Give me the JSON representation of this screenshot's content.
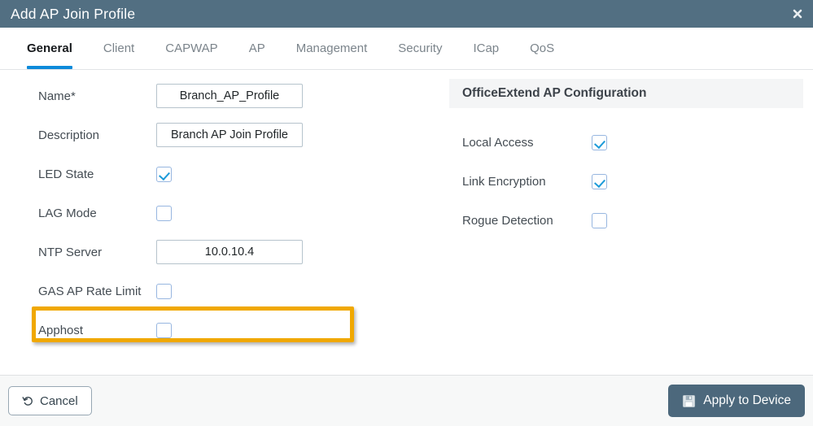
{
  "window": {
    "title": "Add AP Join Profile",
    "close_icon": "close-icon",
    "header_color": "#526f82"
  },
  "tabs": [
    {
      "label": "General",
      "active": true
    },
    {
      "label": "Client",
      "active": false
    },
    {
      "label": "CAPWAP",
      "active": false
    },
    {
      "label": "AP",
      "active": false
    },
    {
      "label": "Management",
      "active": false
    },
    {
      "label": "Security",
      "active": false
    },
    {
      "label": "ICap",
      "active": false
    },
    {
      "label": "QoS",
      "active": false
    }
  ],
  "accent_color": "#0d8ada",
  "general_form": {
    "fields": [
      {
        "label": "Name*",
        "type": "text",
        "value": "Branch_AP_Profile"
      },
      {
        "label": "Description",
        "type": "text",
        "value": "Branch AP Join Profile"
      },
      {
        "label": "LED State",
        "type": "checkbox",
        "checked": true
      },
      {
        "label": "LAG Mode",
        "type": "checkbox",
        "checked": false
      },
      {
        "label": "NTP Server",
        "type": "text",
        "value": "10.0.10.4"
      },
      {
        "label": "GAS AP Rate Limit",
        "type": "checkbox",
        "checked": false
      },
      {
        "label": "Apphost",
        "type": "checkbox",
        "checked": false
      }
    ]
  },
  "officeextend": {
    "section_title": "OfficeExtend AP Configuration",
    "fields": [
      {
        "label": "Local Access",
        "checked": true
      },
      {
        "label": "Link Encryption",
        "checked": true
      },
      {
        "label": "Rogue Detection",
        "checked": false
      }
    ]
  },
  "highlight": {
    "target_label": "NTP Server",
    "color": "#f0a800"
  },
  "footer": {
    "cancel_label": "Cancel",
    "cancel_icon": "undo-arrow-icon",
    "apply_label": "Apply to Device",
    "apply_icon": "save-floppy-icon",
    "apply_color": "#4c687c"
  }
}
